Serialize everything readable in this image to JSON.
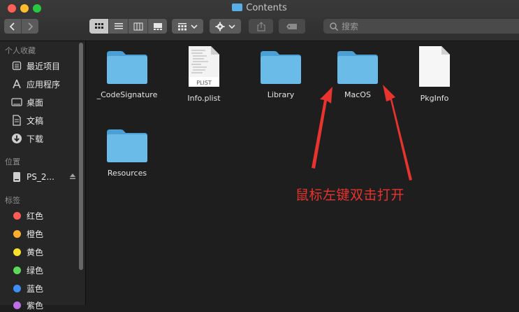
{
  "window": {
    "title": "Contents"
  },
  "toolbar": {
    "search_placeholder": "搜索"
  },
  "sidebar": {
    "favorites_header": "个人收藏",
    "favorites": [
      {
        "label": "最近项目",
        "icon": "recents-icon"
      },
      {
        "label": "应用程序",
        "icon": "applications-icon"
      },
      {
        "label": "桌面",
        "icon": "desktop-icon"
      },
      {
        "label": "文稿",
        "icon": "documents-icon"
      },
      {
        "label": "下载",
        "icon": "downloads-icon"
      }
    ],
    "locations_header": "位置",
    "locations": [
      {
        "label": "PS_2...",
        "icon": "disk-icon"
      }
    ],
    "tags_header": "标签",
    "tags": [
      {
        "label": "红色",
        "color": "#fc5b57"
      },
      {
        "label": "橙色",
        "color": "#fdae2f"
      },
      {
        "label": "黄色",
        "color": "#f9e02d"
      },
      {
        "label": "绿色",
        "color": "#5dd95a"
      },
      {
        "label": "蓝色",
        "color": "#3f8ef8"
      },
      {
        "label": "紫色",
        "color": "#bf6fe3"
      }
    ]
  },
  "files": [
    {
      "name": "_CodeSignature",
      "type": "folder"
    },
    {
      "name": "Info.plist",
      "type": "plist",
      "badge": "PLIST"
    },
    {
      "name": "Library",
      "type": "folder"
    },
    {
      "name": "MacOS",
      "type": "folder"
    },
    {
      "name": "PkgInfo",
      "type": "file"
    },
    {
      "name": "Resources",
      "type": "folder"
    }
  ],
  "annotation": {
    "text": "鼠标左键双击打开",
    "color": "#e8332e"
  }
}
